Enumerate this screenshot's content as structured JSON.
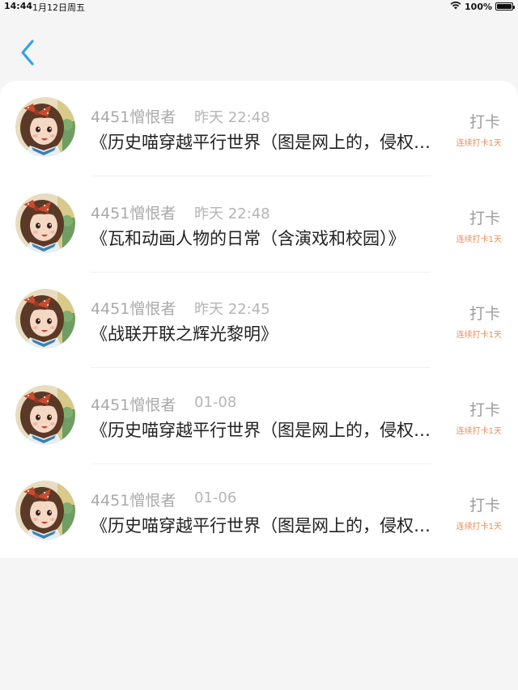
{
  "status_bar": {
    "time": "14:44",
    "date": "1月12日周五",
    "battery": "100%",
    "battery_level": 1.0
  },
  "header": {
    "back_icon": "chevron-left-icon",
    "accent_color": "#2ea2f0"
  },
  "items": [
    {
      "user": "4451憎恨者",
      "time": "昨天 22:48",
      "title": "《历史喵穿越平行世界（图是网上的，侵权删）》",
      "checkin": "打卡",
      "streak": "连续打卡1天"
    },
    {
      "user": "4451憎恨者",
      "time": "昨天 22:48",
      "title": "《瓦和动画人物的日常（含演戏和校园）》",
      "checkin": "打卡",
      "streak": "连续打卡1天"
    },
    {
      "user": "4451憎恨者",
      "time": "昨天 22:45",
      "title": "《战联开联之辉光黎明》",
      "checkin": "打卡",
      "streak": "连续打卡1天"
    },
    {
      "user": "4451憎恨者",
      "time": "01-08",
      "title": "《历史喵穿越平行世界（图是网上的，侵权删）》",
      "checkin": "打卡",
      "streak": "连续打卡1天"
    },
    {
      "user": "4451憎恨者",
      "time": "01-06",
      "title": "《历史喵穿越平行世界（图是网上的，侵权删）》",
      "checkin": "打卡",
      "streak": "连续打卡1天"
    }
  ],
  "colors": {
    "streak": "#ef8a52",
    "page_bg": "#f6f5f5",
    "card_bg": "#ffffff"
  }
}
